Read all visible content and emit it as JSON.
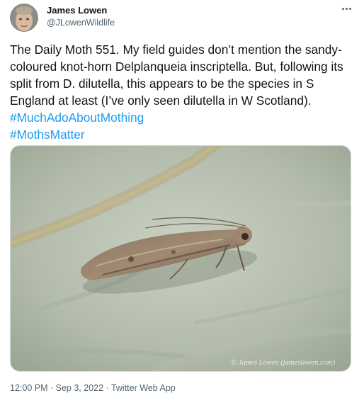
{
  "author": {
    "name": "James Lowen",
    "handle": "@JLowenWildlife"
  },
  "tweet": {
    "text": "The Daily Moth 551. My field guides don’t mention the sandy-coloured knot-horn Delplanqueia inscriptella. But, following its split from D. dilutella, this appears to be the species in S England at least (I’ve only seen dilutella in W Scotland). ",
    "hashtags": [
      "#MuchAdoAboutMothing",
      "#MothsMatter"
    ]
  },
  "media": {
    "credit": "© James Lowen (jameslowen.com)"
  },
  "meta": {
    "time": "12:00 PM",
    "sep1": " · ",
    "date": "Sep 3, 2022",
    "sep2": " · ",
    "client": "Twitter Web App"
  },
  "colors": {
    "link": "#1d9bf0",
    "secondary_text": "#536471"
  }
}
